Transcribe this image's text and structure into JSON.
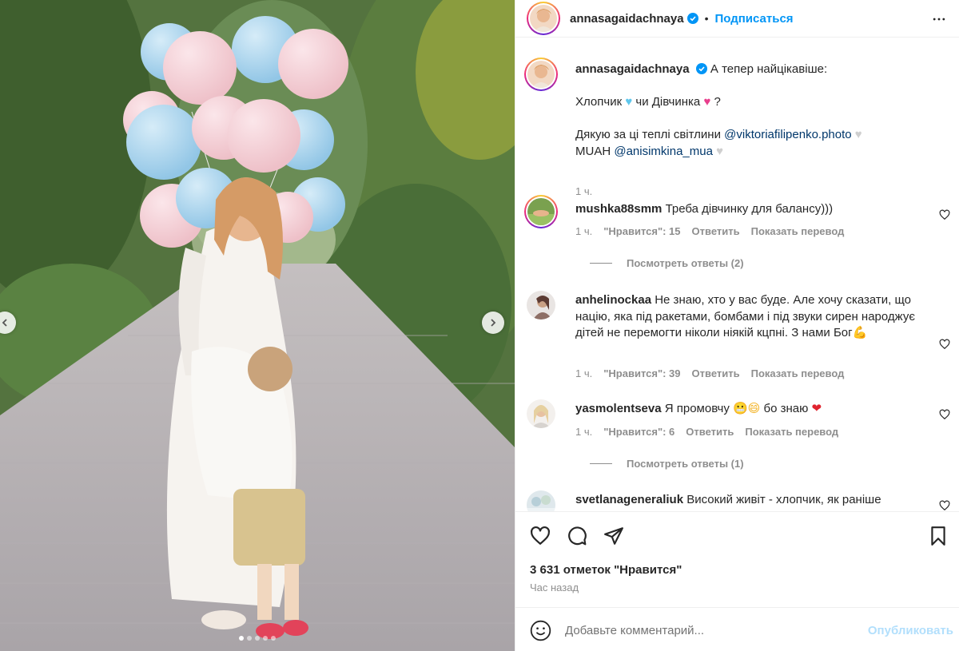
{
  "post": {
    "author": "annasagaidachnaya",
    "follow_label": "Подписаться",
    "separator": "•",
    "caption_lines": {
      "line1": "А тепер найцікавіше:",
      "line2_a": "Хлопчик ",
      "line2_b": " чи Дівчинка ",
      "line2_c": " ?",
      "line3_a": "Дякую за ці теплі світлини ",
      "mention1": "@viktoriafilipenko.photo",
      "line4_a": "MUAH ",
      "mention2": "@anisimkina_mua"
    },
    "caption_time": "1 ч.",
    "likes": "3 631 отметок \"Нравится\"",
    "posted": "Час назад"
  },
  "comments": [
    {
      "user": "mushka88smm",
      "text": "Треба дівчинку для балансу)))",
      "time": "1 ч.",
      "likes": "\"Нравится\": 15",
      "reply": "Ответить",
      "translate": "Показать перевод",
      "replies": "Посмотреть ответы (2)"
    },
    {
      "user": "anhelinockaa",
      "text": "Не знаю, хто у вас буде. Але хочу сказати, що націю, яка під ракетами, бомбами і під звуки сирен народжує дітей не перемогти ніколи ніякій кцпні. З нами Бог",
      "time": "1 ч.",
      "likes": "\"Нравится\": 39",
      "reply": "Ответить",
      "translate": "Показать перевод"
    },
    {
      "user": "yasmolentseva",
      "text": "Я промовчу ",
      "text_tail": " бо знаю ",
      "time": "1 ч.",
      "likes": "\"Нравится\": 6",
      "reply": "Ответить",
      "translate": "Показать перевод",
      "replies": "Посмотреть ответы (1)"
    },
    {
      "user": "svetlanageneraliuk",
      "text": "Високий живіт - хлопчик, як раніше"
    }
  ],
  "input": {
    "placeholder": "Добавьте комментарий...",
    "publish": "Опубликовать"
  },
  "colors": {
    "link": "#0095f6",
    "mention": "#00376b",
    "secondary": "#8e8e8e",
    "publish_disabled": "#b2dffc"
  },
  "icons": [
    "verified-badge-icon",
    "more-options-icon",
    "heart-icon",
    "comment-icon",
    "share-icon",
    "bookmark-icon",
    "emoji-icon",
    "chevron-left-icon",
    "chevron-right-icon"
  ],
  "carousel": {
    "count": 5,
    "active": 1
  }
}
